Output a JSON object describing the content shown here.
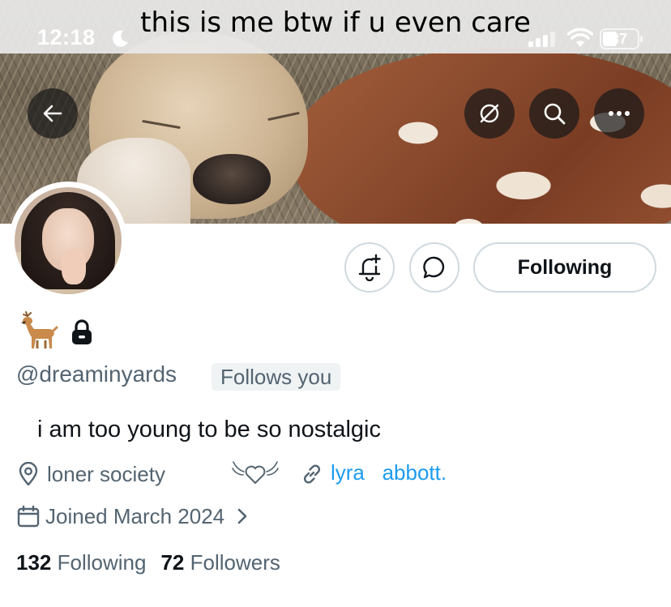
{
  "status_bar": {
    "time": "12:18",
    "battery_level": "37",
    "caption": "this is me btw if u even care"
  },
  "banner": {
    "back_icon": "arrow-left-icon",
    "grok_icon": "grok-icon",
    "search_icon": "search-icon",
    "more_icon": "more-icon"
  },
  "profile": {
    "badge_icons": [
      "deer-emoji-icon",
      "lock-icon"
    ],
    "handle": "@dreaminyards",
    "follows_you": "Follows you",
    "bio": "i am too young to be so nostalgic",
    "location": "loner society",
    "link_text": "lyra   abbott.",
    "joined": "Joined March 2024"
  },
  "actions": {
    "notify_icon": "bell-plus-icon",
    "message_icon": "message-icon",
    "following_label": "Following"
  },
  "stats": {
    "following_count": "132",
    "following_label": "Following",
    "followers_count": "72",
    "followers_label": "Followers"
  },
  "colors": {
    "accent": "#1d9bf0",
    "secondary_text": "#536471",
    "primary_text": "#0f1419",
    "border": "#cfd9de"
  }
}
